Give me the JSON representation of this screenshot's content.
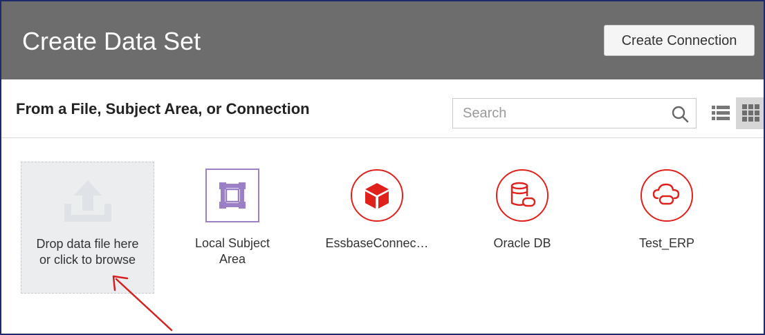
{
  "header": {
    "title": "Create Data Set",
    "create_connection_label": "Create Connection"
  },
  "subheader": {
    "title": "From a File, Subject Area, or Connection",
    "search_placeholder": "Search",
    "view_mode": "grid"
  },
  "drop_zone": {
    "line1": "Drop data file here",
    "line2": "or click to browse",
    "icon": "upload-icon"
  },
  "sources": [
    {
      "label_line1": "Local Subject",
      "label_line2": "Area",
      "icon": "subject-area-icon"
    },
    {
      "label_line1": "EssbaseConnec…",
      "label_line2": "",
      "icon": "essbase-cube-icon"
    },
    {
      "label_line1": "Oracle DB",
      "label_line2": "",
      "icon": "database-icon"
    },
    {
      "label_line1": "Test_ERP",
      "label_line2": "",
      "icon": "cloud-connection-icon"
    }
  ],
  "colors": {
    "header_bg": "#6d6d6d",
    "oracle_red": "#e0201b",
    "subject_area_purple": "#9b7fc7",
    "annotation_arrow": "#d42020"
  }
}
